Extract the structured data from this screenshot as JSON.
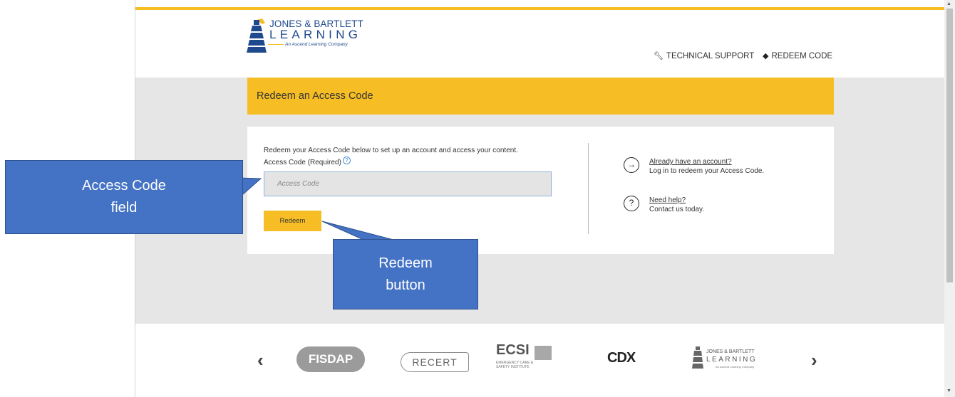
{
  "header": {
    "logo": {
      "line1": "JONES & BARTLETT",
      "line2": "LEARNING",
      "line3": "An Ascend Learning Company"
    },
    "nav": {
      "technical_support": "TECHNICAL SUPPORT",
      "redeem_code": "REDEEM CODE"
    }
  },
  "main": {
    "title": "Redeem an Access Code",
    "intro": "Redeem your Access Code below to set up an account and access your content.",
    "code_label": "Access Code (Required)",
    "help_glyph": "?",
    "code_placeholder": "Access Code",
    "redeem_label": "Redeem",
    "side": {
      "account_link": "Already have an account?",
      "account_desc": "Log in to redeem your Access Code.",
      "help_link": "Need help?",
      "help_desc": "Contact us today."
    }
  },
  "carousel": {
    "brands": [
      "FISDAP",
      "RECERT",
      "ECSI",
      "CDX",
      "JONES & BARTLETT LEARNING"
    ],
    "ecsi_sub": "EMERGENCY CARE & SAFETY INSTITUTE",
    "jb_small": {
      "line1": "JONES & BARTLETT",
      "line2": "LEARNING",
      "line3": "An Ascend Learning Company"
    }
  },
  "callouts": {
    "access_code": "Access Code field",
    "redeem_button": "Redeem button"
  },
  "colors": {
    "accent": "#f6bd25",
    "band": "#e6e6e6",
    "callout": "#4472c4",
    "brand_blue": "#1e4a8d"
  },
  "icons": [
    "wrench-icon",
    "tag-icon",
    "arrow-right-circle-icon",
    "question-circle-icon",
    "chevron-left-icon",
    "chevron-right-icon"
  ]
}
